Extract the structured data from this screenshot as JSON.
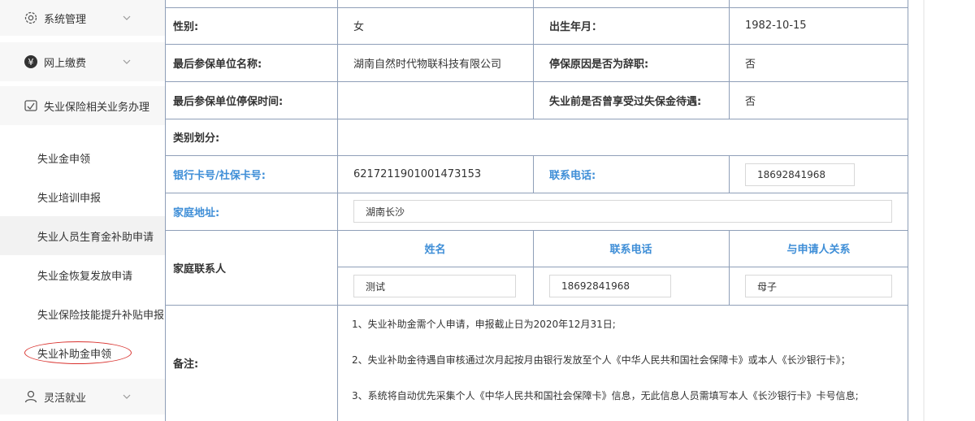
{
  "sidebar": {
    "groups": [
      {
        "label": "系统管理",
        "icon": "gear-icon"
      },
      {
        "label": "网上缴费",
        "icon": "yen-icon"
      },
      {
        "label": "失业保险相关业务办理",
        "icon": "handshake-icon"
      },
      {
        "label": "灵活就业",
        "icon": "user-icon"
      }
    ],
    "subitems": [
      {
        "label": "失业金申领"
      },
      {
        "label": "失业培训申报"
      },
      {
        "label": "失业人员生育金补助申请"
      },
      {
        "label": "失业金恢复发放申请"
      },
      {
        "label": "失业保险技能提升补贴申报"
      },
      {
        "label": "失业补助金申领"
      }
    ]
  },
  "form": {
    "gender_label": "性别:",
    "gender_value": "女",
    "birth_label": "出生年月：",
    "birth_value": "1982-10-15",
    "last_unit_label": "最后参保单位名称:",
    "last_unit_value": "湖南自然时代物联科技有限公司",
    "stop_reason_label": "停保原因是否为辞职:",
    "stop_reason_value": "否",
    "stop_time_label": "最后参保单位停保时间:",
    "stop_time_value": "",
    "enjoyed_label": "失业前是否曾享受过失保金待遇:",
    "enjoyed_value": "否",
    "category_label": "类别划分:",
    "bank_label": "银行卡号/社保卡号:",
    "bank_value": "6217211901001473153",
    "phone_label": "联系电话:",
    "phone_value": "18692841968",
    "address_label": "家庭地址:",
    "address_value": "湖南长沙",
    "family_label": "家庭联系人",
    "family_headers": [
      "姓名",
      "联系电话",
      "与申请人关系"
    ],
    "family_name": "测试",
    "family_phone": "18692841968",
    "family_relation": "母子",
    "remarks_label": "备注:",
    "notes": [
      "1、失业补助金需个人申请，申报截止日为2020年12月31日;",
      "2、失业补助金待遇自审核通过次月起按月由银行发放至个人《中华人民共和国社会保障卡》或本人《长沙银行卡》；",
      "3、系统将自动优先采集个人《中华人民共和国社会保障卡》信息，无此信息人员需填写本人《长沙银行卡》卡号信息;"
    ]
  }
}
